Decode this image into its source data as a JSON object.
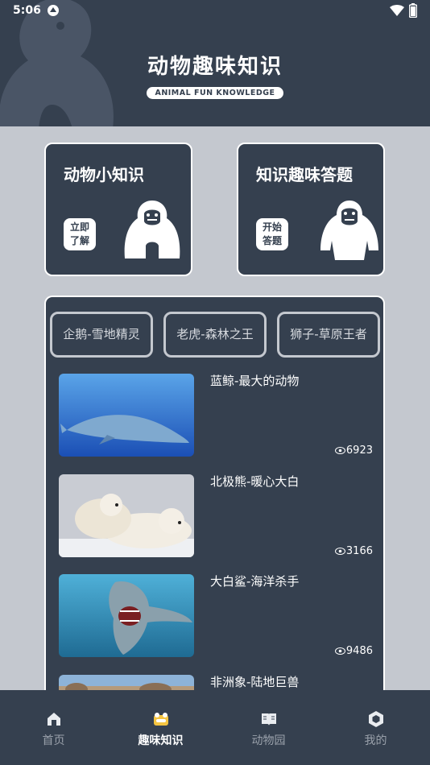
{
  "status_bar": {
    "time": "5:06"
  },
  "header": {
    "title": "动物趣味知识",
    "subtitle": "ANIMAL FUN KNOWLEDGE"
  },
  "features": [
    {
      "title": "动物小知识",
      "button_line1": "立即",
      "button_line2": "了解"
    },
    {
      "title": "知识趣味答题",
      "button_line1": "开始",
      "button_line2": "答题"
    }
  ],
  "chips": [
    "企鹅-雪地精灵",
    "老虎-森林之王",
    "狮子-草原王者"
  ],
  "items": [
    {
      "title": "蓝鲸-最大的动物",
      "views": "6923",
      "image": "blue-whale"
    },
    {
      "title": "北极熊-暖心大白",
      "views": "3166",
      "image": "polar-bear"
    },
    {
      "title": "大白鲨-海洋杀手",
      "views": "9486",
      "image": "great-white-shark"
    },
    {
      "title": "非洲象-陆地巨兽",
      "views": "",
      "image": "african-elephant"
    }
  ],
  "nav": [
    {
      "label": "首页",
      "icon": "home-icon"
    },
    {
      "label": "趣味知识",
      "icon": "fun-knowledge-icon"
    },
    {
      "label": "动物园",
      "icon": "book-icon"
    },
    {
      "label": "我的",
      "icon": "profile-hexagon-icon"
    }
  ],
  "colors": {
    "primary_dark": "#35404f",
    "background": "#c4c8cf",
    "white": "#ffffff",
    "accent_yellow": "#f5c542"
  }
}
